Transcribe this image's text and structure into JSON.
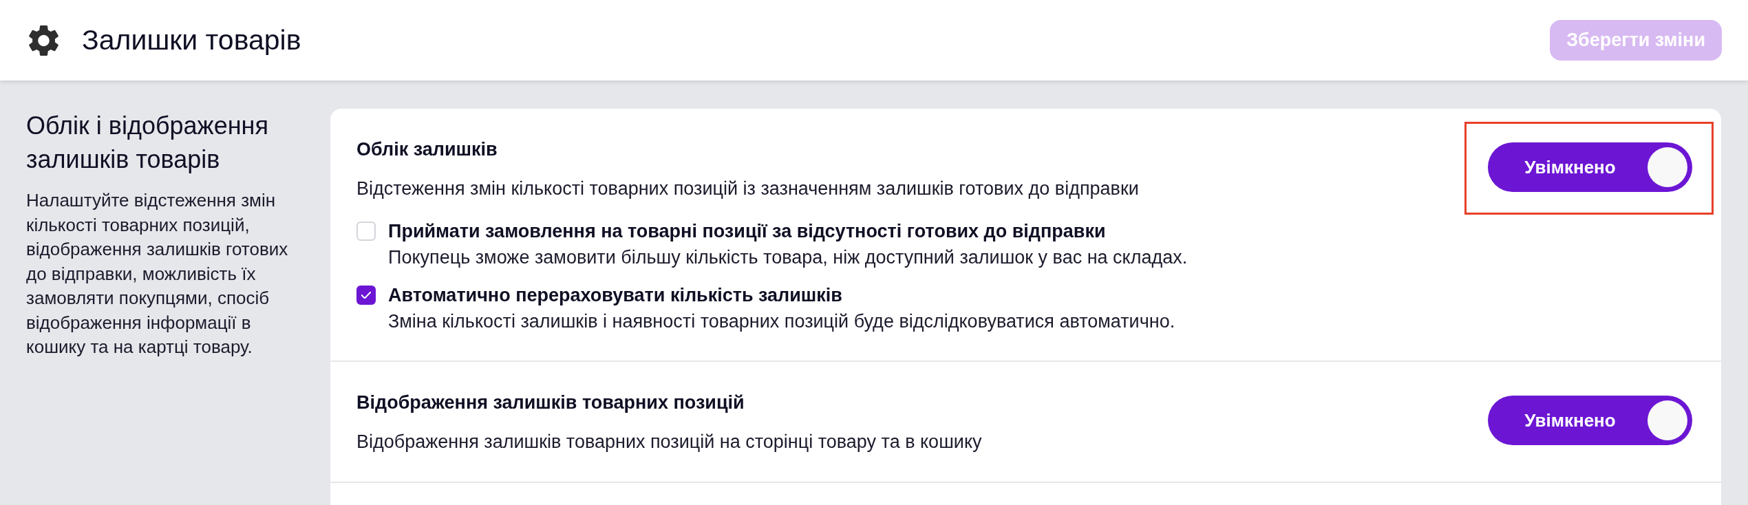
{
  "header": {
    "title": "Залишки товарів",
    "save_button": {
      "label": "Зберегти зміни",
      "disabled": true
    }
  },
  "sidebar": {
    "title": "Облік і відображення залишків товарів",
    "description": "Налаштуйте відстеження змін кількості товарних позицій, відображення залишків готових до відправки, можливість їх замовляти покупцями, спосіб відображення інформації в кошику та на картці товару."
  },
  "sections": [
    {
      "title": "Облік залишків",
      "description": "Відстеження змін кількості товарних позицій із зазначенням залишків готових до відправки",
      "toggle": {
        "label": "Увімкнено",
        "on": true
      },
      "highlighted": true,
      "options": [
        {
          "label": "Приймати замовлення на товарні позиції за відсутності готових до відправки",
          "description": "Покупець зможе замовити більшу кількість товара, ніж доступний залишок у вас на складах.",
          "checked": false
        },
        {
          "label": "Автоматично перераховувати кількість залишків",
          "description": "Зміна кількості залишків і наявності товарних позицій буде відслідковуватися автоматично.",
          "checked": true
        }
      ]
    },
    {
      "title": "Відображення залишків товарних позицій",
      "description": "Відображення залишків товарних позицій на сторінці товару та в кошику",
      "toggle": {
        "label": "Увімкнено",
        "on": true
      },
      "highlighted": false
    }
  ]
}
